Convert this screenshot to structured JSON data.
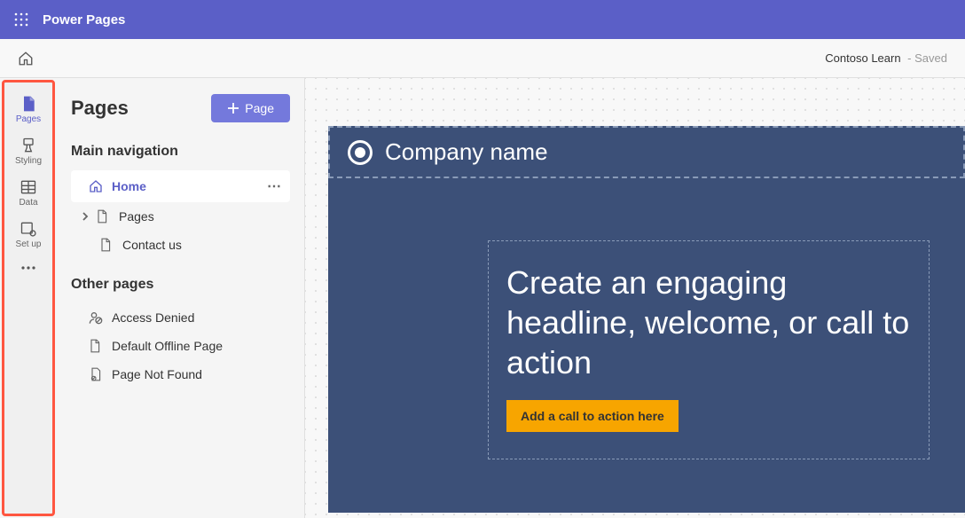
{
  "brand": "Power Pages",
  "status": {
    "site": "Contoso Learn",
    "state": "Saved"
  },
  "rail": {
    "items": [
      {
        "label": "Pages"
      },
      {
        "label": "Styling"
      },
      {
        "label": "Data"
      },
      {
        "label": "Set up"
      }
    ]
  },
  "panel": {
    "title": "Pages",
    "add_button": "Page",
    "sections": {
      "main_nav": {
        "label": "Main navigation",
        "items": [
          {
            "label": "Home"
          },
          {
            "label": "Pages"
          },
          {
            "label": "Contact us"
          }
        ]
      },
      "other": {
        "label": "Other pages",
        "items": [
          {
            "label": "Access Denied"
          },
          {
            "label": "Default Offline Page"
          },
          {
            "label": "Page Not Found"
          }
        ]
      }
    }
  },
  "canvas": {
    "company": "Company name",
    "headline": "Create an engaging headline, welcome, or call to action",
    "cta": "Add a call to action here"
  }
}
